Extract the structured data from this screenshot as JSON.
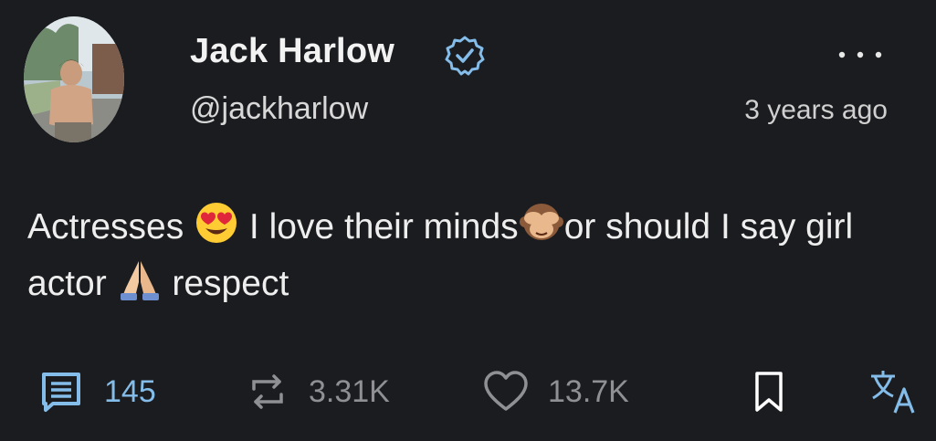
{
  "post": {
    "author": {
      "display_name": "Jack Harlow",
      "handle": "@jackharlow",
      "verified": true,
      "avatar_icon": "avatar-photo"
    },
    "timestamp": "3 years ago",
    "text_segments": [
      "Actresses ",
      " I love their minds",
      "or should I say girl actor ",
      " respect"
    ],
    "emojis": [
      "heart-eyes-emoji",
      "see-no-evil-monkey-emoji",
      "folded-hands-emoji"
    ]
  },
  "actions": {
    "reply": {
      "icon": "comment-icon",
      "count": "145",
      "color": "#84bde9"
    },
    "repost": {
      "icon": "repost-icon",
      "count": "3.31K",
      "color": "#8e9094"
    },
    "like": {
      "icon": "heart-icon",
      "count": "13.7K",
      "color": "#8e9094"
    },
    "bookmark": {
      "icon": "bookmark-icon",
      "color": "#ffffff"
    },
    "translate": {
      "icon": "translate-icon",
      "color": "#84bde9"
    }
  },
  "theme": {
    "background": "#1b1c1f",
    "accent": "#84bde9",
    "text": "#eeeeee"
  }
}
